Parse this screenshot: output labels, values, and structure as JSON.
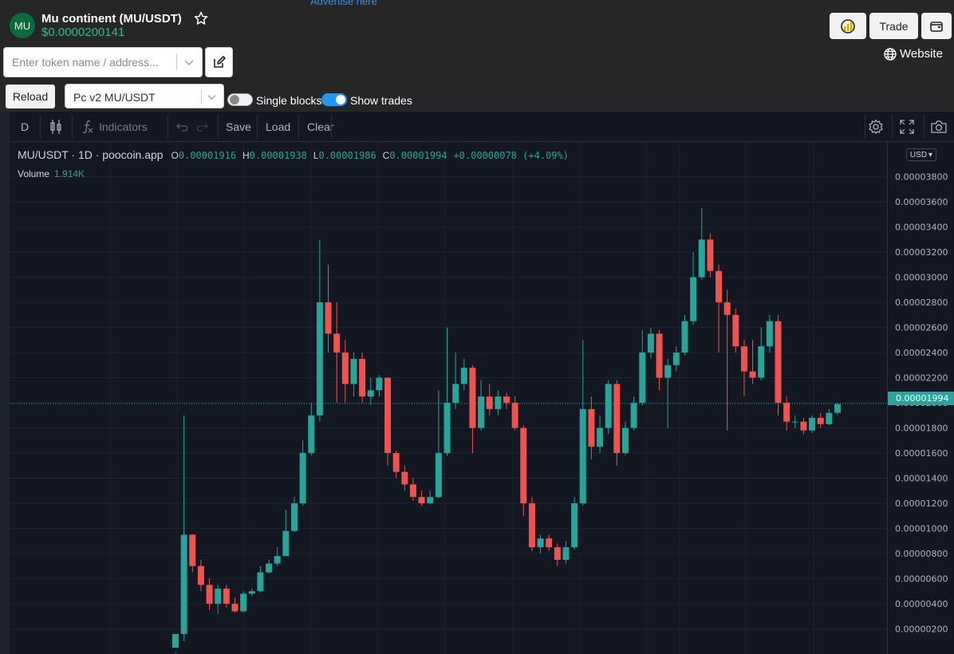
{
  "header": {
    "advertise": "Advertise here",
    "logo_text": "MU",
    "token_title": "Mu continent (MU/USDT)",
    "token_price": "$0.0000200141",
    "icons": {
      "favorite": "star-icon"
    }
  },
  "search": {
    "placeholder": "Enter token name / address...",
    "value": ""
  },
  "actions": {
    "chart_icon": "chart-gauge-icon",
    "trade_label": "Trade",
    "wallet_icon": "wallet-icon",
    "website_label": "Website"
  },
  "controls": {
    "reload_label": "Reload",
    "pair_selected": "Pc v2 MU/USDT",
    "single_blocks_label": "Single blocks",
    "single_blocks_on": false,
    "show_trades_label": "Show trades",
    "show_trades_on": true
  },
  "toolbar": {
    "interval": "D",
    "indicators_label": "Indicators",
    "save_label": "Save",
    "load_label": "Load",
    "clear_label": "Clear"
  },
  "legend": {
    "symbol": "MU/USDT · 1D · poocoin.app",
    "o_label": "O",
    "o_value": "0.00001916",
    "h_label": "H",
    "h_value": "0.00001938",
    "l_label": "L",
    "l_value": "0.00001986",
    "c_label": "C",
    "c_value": "0.00001994",
    "change": "+0.00000078 (+4.09%)",
    "volume_label": "Volume",
    "volume_value": "1.914K"
  },
  "price_axis": {
    "currency": "USD",
    "last_price_tag": "0.00001994"
  },
  "colors": {
    "up": "#26a69a",
    "down": "#ef5350",
    "background": "#131722",
    "price_green": "#2ebd85"
  },
  "chart_data": {
    "type": "candlestick",
    "y_ticks": [
      2e-06,
      4e-06,
      6e-06,
      8e-06,
      1e-05,
      1.2e-05,
      1.4e-05,
      1.6e-05,
      1.8e-05,
      2e-05,
      2.2e-05,
      2.4e-05,
      2.6e-05,
      2.8e-05,
      3e-05,
      3.2e-05,
      3.4e-05,
      3.6e-05,
      3.8e-05
    ],
    "y_tick_labels": [
      "0.00000200",
      "0.00000400",
      "0.00000600",
      "0.00000800",
      "0.00001000",
      "0.00001200",
      "0.00001400",
      "0.00001600",
      "0.00001800",
      "0.00002000",
      "0.00002200",
      "0.00002400",
      "0.00002600",
      "0.00002800",
      "0.00003000",
      "0.00003200",
      "0.00003400",
      "0.00003600",
      "0.00003800"
    ],
    "ylim": [
      0.0,
      3.88e-05
    ],
    "last_price": 1.994e-05,
    "candles": [
      [
        5e-07,
        1.6e-06,
        0.0,
        1e-07
      ],
      [
        1.6e-06,
        9.5e-06,
        1.9e-05,
        1e-06
      ],
      [
        9.5e-06,
        7e-06,
        9.5e-06,
        6.5e-06
      ],
      [
        7e-06,
        5.5e-06,
        7.5e-06,
        5e-06
      ],
      [
        5.5e-06,
        4e-06,
        6e-06,
        3.5e-06
      ],
      [
        4e-06,
        5.2e-06,
        5.5e-06,
        3.2e-06
      ],
      [
        5.2e-06,
        4e-06,
        5.5e-06,
        3.7e-06
      ],
      [
        4e-06,
        3.4e-06,
        4.5e-06,
        3.3e-06
      ],
      [
        3.4e-06,
        4.8e-06,
        5e-06,
        3.3e-06
      ],
      [
        4.8e-06,
        5e-06,
        5.2e-06,
        4.6e-06
      ],
      [
        5e-06,
        6.5e-06,
        7e-06,
        4.9e-06
      ],
      [
        6.5e-06,
        7.2e-06,
        7.5e-06,
        6.4e-06
      ],
      [
        7.2e-06,
        7.8e-06,
        8.5e-06,
        7e-06
      ],
      [
        7.8e-06,
        9.8e-06,
        1.15e-05,
        7.8e-06
      ],
      [
        9.8e-06,
        1.2e-05,
        1.25e-05,
        9.7e-06
      ],
      [
        1.2e-05,
        1.6e-05,
        1.7e-05,
        1.18e-05
      ],
      [
        1.6e-05,
        1.9e-05,
        2e-05,
        1.58e-05
      ],
      [
        1.9e-05,
        2.8e-05,
        3.3e-05,
        1.85e-05
      ],
      [
        2.8e-05,
        2.55e-05,
        3.1e-05,
        2.4e-05
      ],
      [
        2.55e-05,
        2.4e-05,
        2.8e-05,
        2e-05
      ],
      [
        2.4e-05,
        2.15e-05,
        2.5e-05,
        2e-05
      ],
      [
        2.15e-05,
        2.35e-05,
        2.4e-05,
        2.05e-05
      ],
      [
        2.35e-05,
        2.05e-05,
        2.4e-05,
        2e-05
      ],
      [
        2.05e-05,
        2.1e-05,
        2.2e-05,
        1.98e-05
      ],
      [
        2.1e-05,
        2.2e-05,
        2.22e-05,
        2.05e-05
      ],
      [
        2.2e-05,
        1.6e-05,
        2.2e-05,
        1.5e-05
      ],
      [
        1.6e-05,
        1.45e-05,
        1.62e-05,
        1.4e-05
      ],
      [
        1.45e-05,
        1.35e-05,
        1.5e-05,
        1.3e-05
      ],
      [
        1.35e-05,
        1.25e-05,
        1.4e-05,
        1.22e-05
      ],
      [
        1.25e-05,
        1.2e-05,
        1.3e-05,
        1.18e-05
      ],
      [
        1.2e-05,
        1.25e-05,
        1.3e-05,
        1.19e-05
      ],
      [
        1.25e-05,
        1.6e-05,
        2.1e-05,
        1.24e-05
      ],
      [
        1.6e-05,
        2e-05,
        2.6e-05,
        1.58e-05
      ],
      [
        2e-05,
        2.15e-05,
        2.4e-05,
        1.95e-05
      ],
      [
        2.15e-05,
        2.28e-05,
        2.35e-05,
        2.1e-05
      ],
      [
        2.28e-05,
        1.8e-05,
        2.3e-05,
        1.6e-05
      ],
      [
        1.8e-05,
        2.05e-05,
        2.18e-05,
        1.78e-05
      ],
      [
        2.05e-05,
        1.95e-05,
        2.15e-05,
        1.9e-05
      ],
      [
        1.95e-05,
        2.05e-05,
        2.1e-05,
        1.9e-05
      ],
      [
        2.05e-05,
        2e-05,
        2.08e-05,
        1.95e-05
      ],
      [
        2e-05,
        1.8e-05,
        2.05e-05,
        1.78e-05
      ],
      [
        1.8e-05,
        1.2e-05,
        1.82e-05,
        1.1e-05
      ],
      [
        1.2e-05,
        8.5e-06,
        1.25e-05,
        8.2e-06
      ],
      [
        8.5e-06,
        9.2e-06,
        9.5e-06,
        8e-06
      ],
      [
        9.2e-06,
        8.5e-06,
        9.5e-06,
        8.2e-06
      ],
      [
        8.5e-06,
        7.5e-06,
        8.8e-06,
        7e-06
      ],
      [
        7.5e-06,
        8.5e-06,
        9e-06,
        7.2e-06
      ],
      [
        8.5e-06,
        1.2e-05,
        1.25e-05,
        8.3e-06
      ],
      [
        1.2e-05,
        1.95e-05,
        2.5e-05,
        1.18e-05
      ],
      [
        1.95e-05,
        1.65e-05,
        2.05e-05,
        1.55e-05
      ],
      [
        1.65e-05,
        1.8e-05,
        1.9e-05,
        1.6e-05
      ],
      [
        1.8e-05,
        2.15e-05,
        2.18e-05,
        1.75e-05
      ],
      [
        2.15e-05,
        1.6e-05,
        2.18e-05,
        1.5e-05
      ],
      [
        1.6e-05,
        1.8e-05,
        1.85e-05,
        1.58e-05
      ],
      [
        1.8e-05,
        2e-05,
        2.05e-05,
        1.78e-05
      ],
      [
        2e-05,
        2.4e-05,
        2.58e-05,
        1.98e-05
      ],
      [
        2.4e-05,
        2.55e-05,
        2.6e-05,
        2.35e-05
      ],
      [
        2.55e-05,
        2.2e-05,
        2.58e-05,
        2.1e-05
      ],
      [
        2.2e-05,
        2.3e-05,
        2.35e-05,
        1.8e-05
      ],
      [
        2.3e-05,
        2.4e-05,
        2.45e-05,
        2.25e-05
      ],
      [
        2.4e-05,
        2.65e-05,
        2.7e-05,
        2.38e-05
      ],
      [
        2.65e-05,
        3e-05,
        3.2e-05,
        2.62e-05
      ],
      [
        3e-05,
        3.3e-05,
        3.55e-05,
        2.98e-05
      ],
      [
        3.3e-05,
        3.05e-05,
        3.35e-05,
        3e-05
      ],
      [
        3.05e-05,
        2.8e-05,
        3.1e-05,
        2.4e-05
      ],
      [
        2.8e-05,
        2.7e-05,
        2.9e-05,
        1.78e-05
      ],
      [
        2.7e-05,
        2.45e-05,
        2.75e-05,
        2.4e-05
      ],
      [
        2.45e-05,
        2.25e-05,
        2.5e-05,
        2.05e-05
      ],
      [
        2.25e-05,
        2.2e-05,
        2.5e-05,
        2.15e-05
      ],
      [
        2.2e-05,
        2.45e-05,
        2.6e-05,
        2.18e-05
      ],
      [
        2.45e-05,
        2.65e-05,
        2.7e-05,
        2.4e-05
      ],
      [
        2.65e-05,
        2e-05,
        2.7e-05,
        1.9e-05
      ],
      [
        2e-05,
        1.85e-05,
        2.05e-05,
        1.78e-05
      ],
      [
        1.85e-05,
        1.85e-05,
        1.9e-05,
        1.8e-05
      ],
      [
        1.85e-05,
        1.78e-05,
        1.88e-05,
        1.75e-05
      ],
      [
        1.78e-05,
        1.88e-05,
        1.9e-05,
        1.76e-05
      ],
      [
        1.88e-05,
        1.83e-05,
        1.92e-05,
        1.8e-05
      ],
      [
        1.83e-05,
        1.92e-05,
        1.95e-05,
        1.82e-05
      ],
      [
        1.92e-05,
        1.99e-05,
        2e-05,
        1.9e-05
      ]
    ]
  }
}
